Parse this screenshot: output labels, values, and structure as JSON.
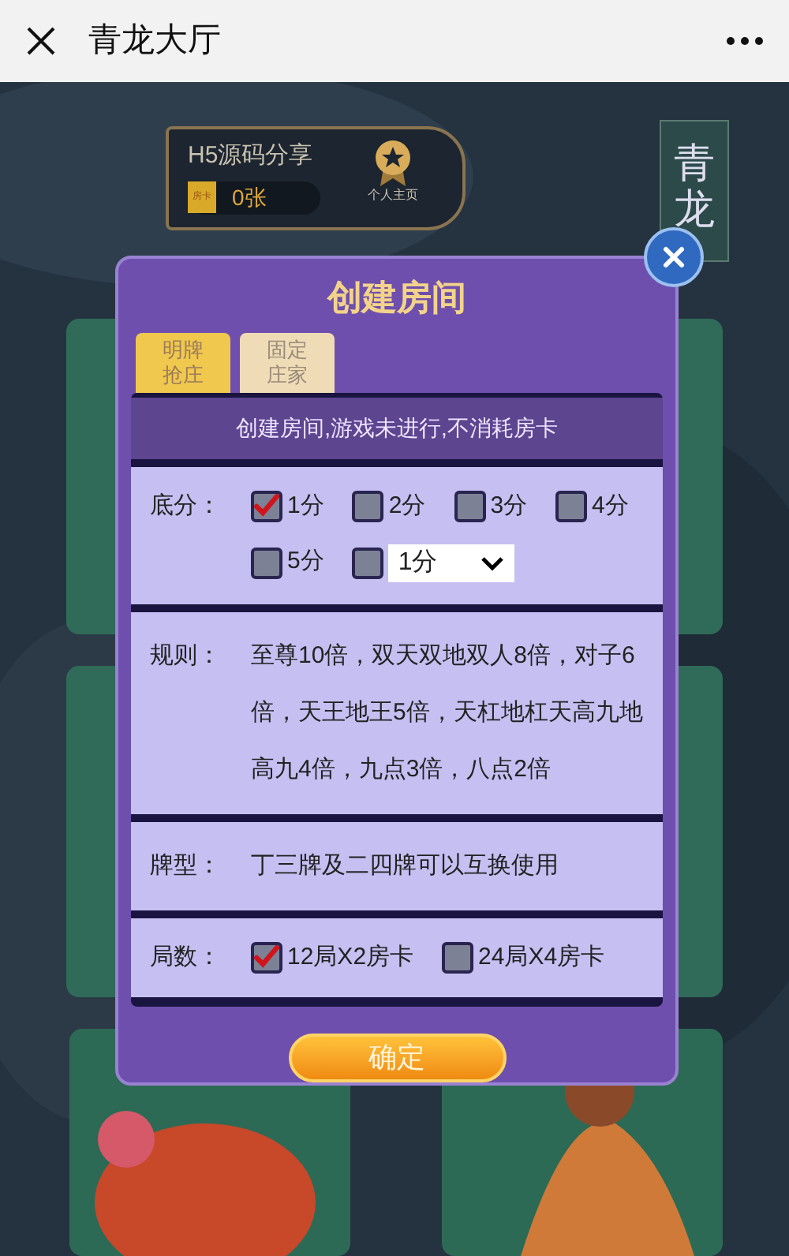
{
  "header": {
    "title": "青龙大厅"
  },
  "profile": {
    "name": "H5源码分享",
    "card_label": "房卡",
    "cards": "0张",
    "home_label": "个人主页"
  },
  "side_sign": "青龙",
  "dialog": {
    "title": "创建房间",
    "tabs": [
      {
        "lines": [
          "明牌",
          "抢庄"
        ],
        "selected": true
      },
      {
        "lines": [
          "固定",
          "庄家"
        ],
        "selected": false
      }
    ],
    "notice": "创建房间,游戏未进行,不消耗房卡",
    "sections": [
      {
        "kind": "options",
        "label": "底分：",
        "options": [
          {
            "label": "1分",
            "checked": true
          },
          {
            "label": "2分",
            "checked": false
          },
          {
            "label": "3分",
            "checked": false
          },
          {
            "label": "4分",
            "checked": false
          },
          {
            "label": "5分",
            "checked": false
          }
        ],
        "custom": {
          "checked": false,
          "value": "1分"
        }
      },
      {
        "kind": "text",
        "label": "规则：",
        "text": "至尊10倍，双天双地双人8倍，对子6倍，天王地王5倍，天杠地杠天高九地高九4倍，九点3倍，八点2倍"
      },
      {
        "kind": "text",
        "label": "牌型：",
        "text": "丁三牌及二四牌可以互换使用"
      },
      {
        "kind": "options",
        "label": "局数：",
        "options": [
          {
            "label": "12局X2房卡",
            "checked": true
          },
          {
            "label": "24局X4房卡",
            "checked": false
          }
        ]
      }
    ],
    "confirm": "确定"
  }
}
